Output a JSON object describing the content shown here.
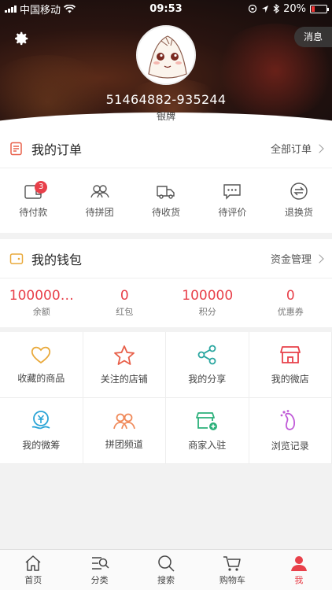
{
  "status_bar": {
    "carrier": "中国移动",
    "time": "09:53",
    "battery": "20%"
  },
  "header": {
    "message_label": "消息",
    "username": "51464882-935244",
    "level": "银牌"
  },
  "orders": {
    "title": "我的订单",
    "more": "全部订单",
    "items": [
      {
        "label": "待付款",
        "icon": "wallet-icon",
        "badge": "3"
      },
      {
        "label": "待拼团",
        "icon": "group-icon"
      },
      {
        "label": "待收货",
        "icon": "truck-icon"
      },
      {
        "label": "待评价",
        "icon": "comment-icon"
      },
      {
        "label": "退换货",
        "icon": "exchange-icon"
      }
    ]
  },
  "wallet": {
    "title": "我的钱包",
    "more": "资金管理",
    "items": [
      {
        "value": "100000…",
        "label": "余额"
      },
      {
        "value": "0",
        "label": "红包"
      },
      {
        "value": "100000",
        "label": "积分"
      },
      {
        "value": "0",
        "label": "优惠券"
      }
    ]
  },
  "services": [
    {
      "label": "收藏的商品",
      "icon": "heart-icon",
      "color": "#e9a93a"
    },
    {
      "label": "关注的店铺",
      "icon": "star-icon",
      "color": "#e8604a"
    },
    {
      "label": "我的分享",
      "icon": "share-icon",
      "color": "#2aa6a0"
    },
    {
      "label": "我的微店",
      "icon": "shop-icon",
      "color": "#e8404a"
    },
    {
      "label": "我的微筹",
      "icon": "crowdfund-icon",
      "color": "#29a3d6"
    },
    {
      "label": "拼团频道",
      "icon": "group-icon",
      "color": "#f08a5a"
    },
    {
      "label": "商家入驻",
      "icon": "store-add-icon",
      "color": "#2bb07a"
    },
    {
      "label": "浏览记录",
      "icon": "footprint-icon",
      "color": "#c05ad8"
    }
  ],
  "tabbar": [
    {
      "label": "首页",
      "icon": "home-icon"
    },
    {
      "label": "分类",
      "icon": "category-icon"
    },
    {
      "label": "搜索",
      "icon": "search-icon"
    },
    {
      "label": "购物车",
      "icon": "cart-icon"
    },
    {
      "label": "我",
      "icon": "user-icon",
      "active": true
    }
  ],
  "colors": {
    "accent": "#e8404a",
    "background": "#f2f2f2"
  }
}
